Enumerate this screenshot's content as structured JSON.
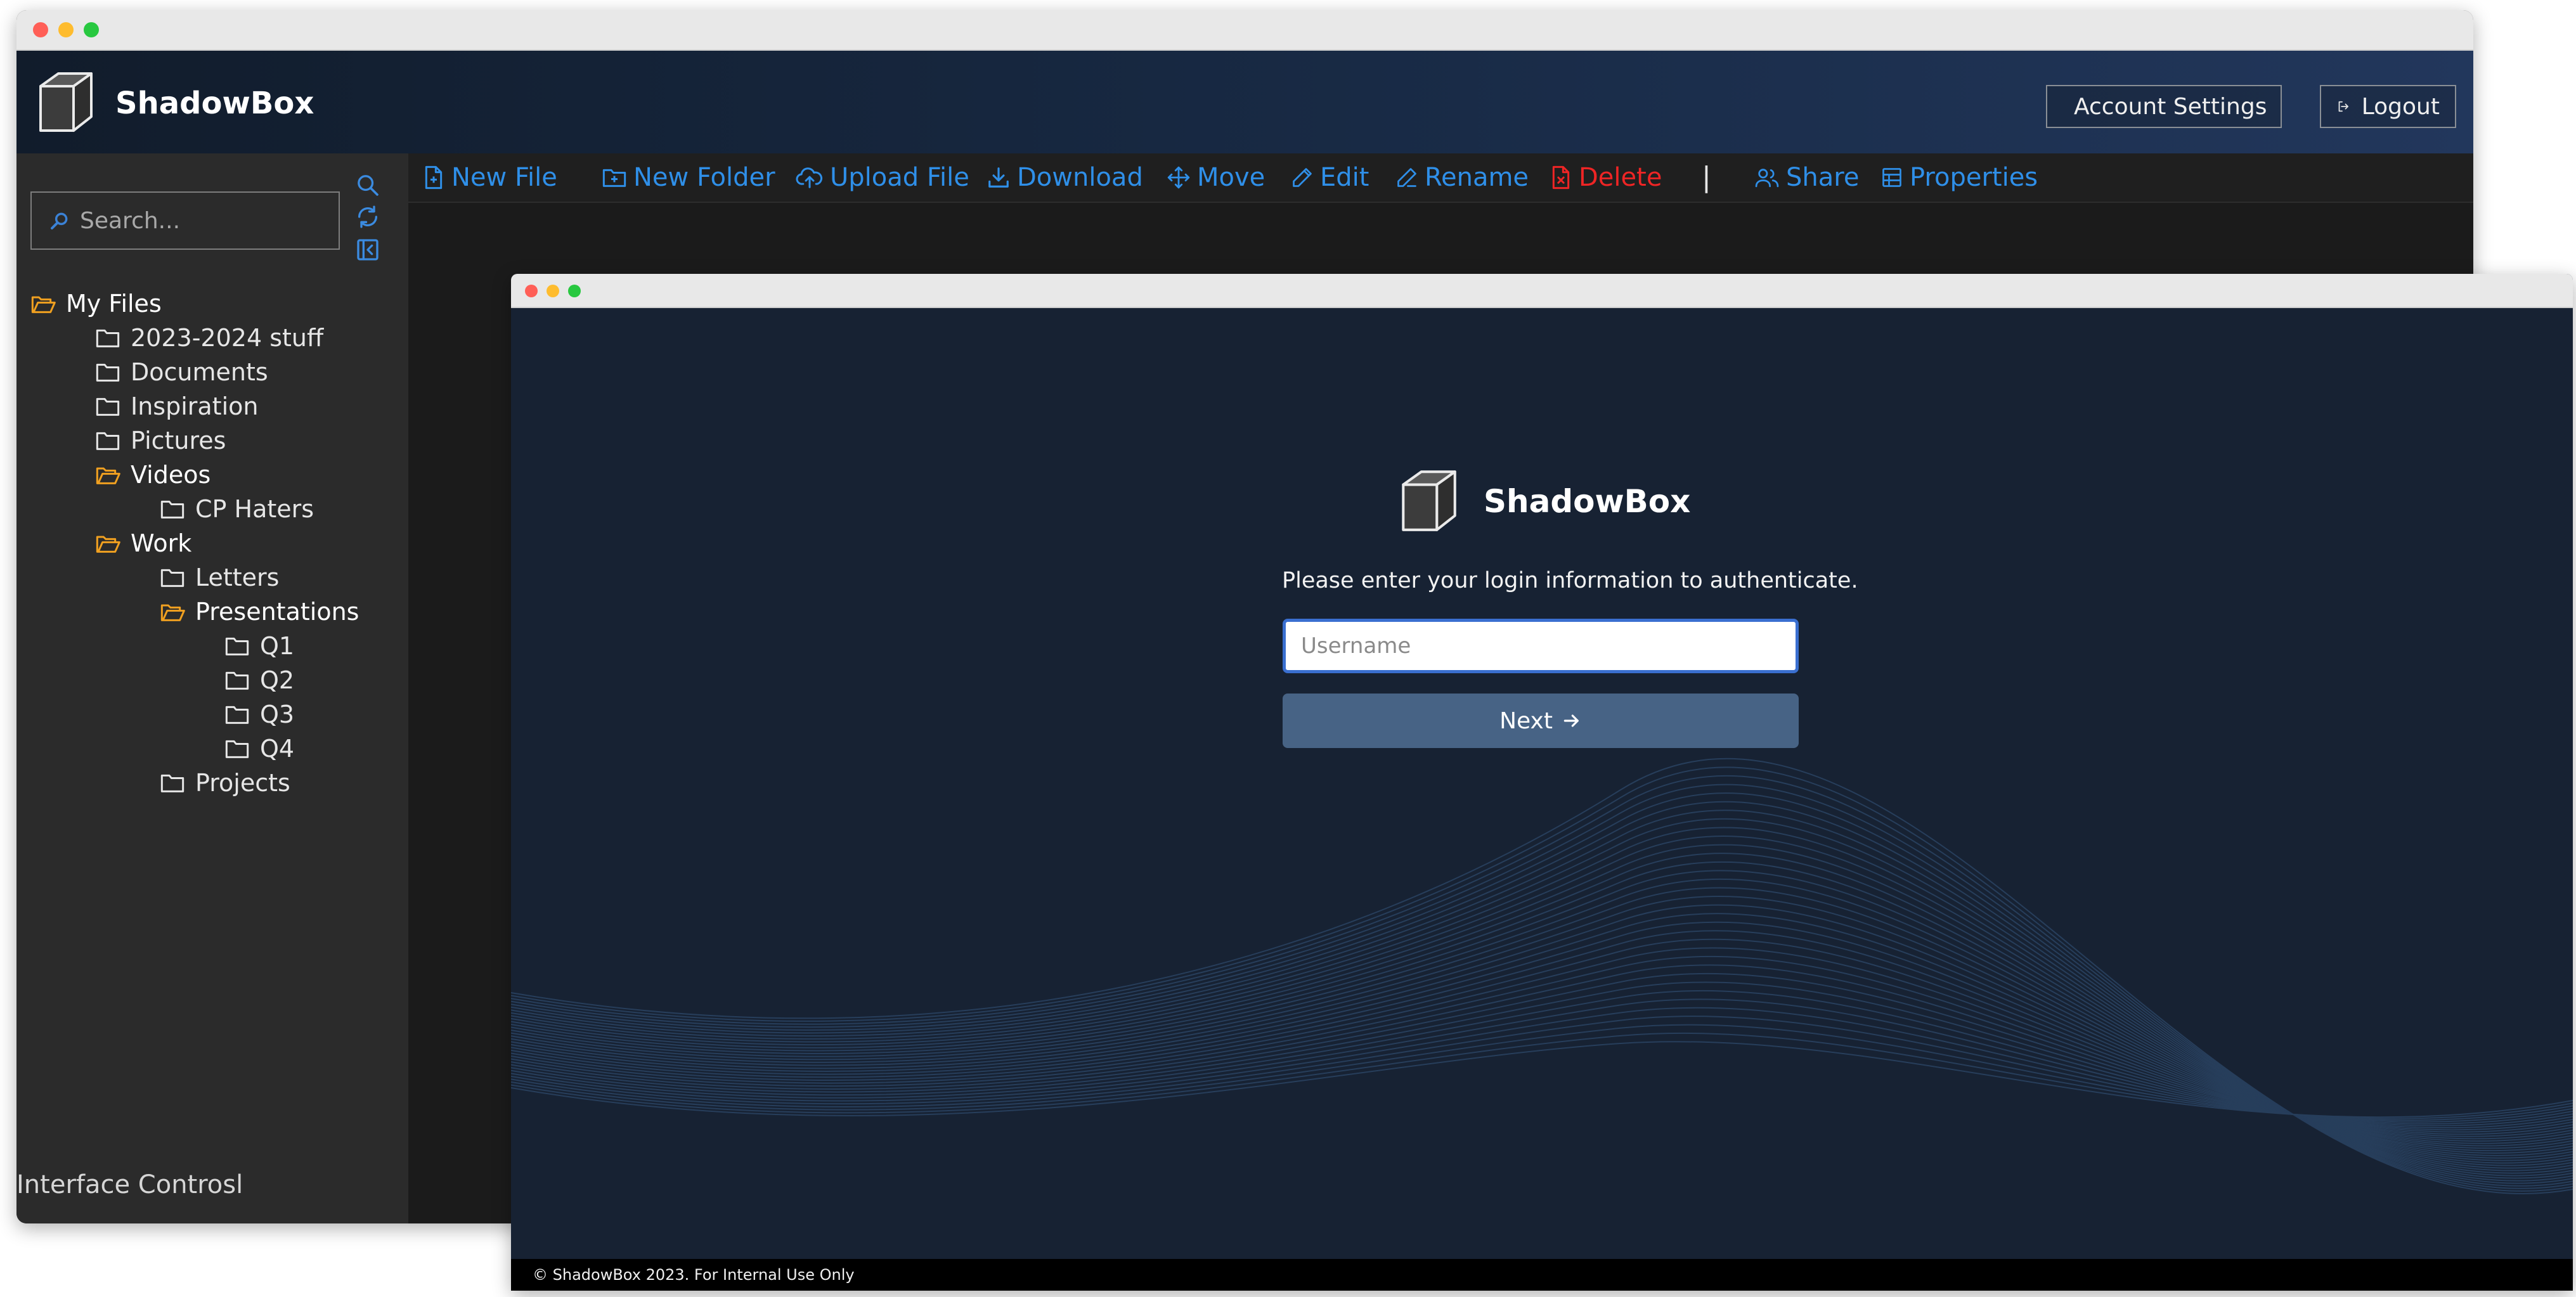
{
  "app": {
    "name": "ShadowBox"
  },
  "header": {
    "account_settings_label": "Account Settings",
    "logout_label": "Logout"
  },
  "sidebar": {
    "search_placeholder": "Search...",
    "tree": [
      {
        "label": "My Files",
        "open": true
      },
      {
        "label": "2023-2024 stuff",
        "open": false
      },
      {
        "label": "Documents",
        "open": false
      },
      {
        "label": "Inspiration",
        "open": false
      },
      {
        "label": "Pictures",
        "open": false
      },
      {
        "label": "Videos",
        "open": true
      },
      {
        "label": "CP Haters",
        "open": false
      },
      {
        "label": "Work",
        "open": true
      },
      {
        "label": "Letters",
        "open": false
      },
      {
        "label": "Presentations",
        "open": true
      },
      {
        "label": "Q1",
        "open": false
      },
      {
        "label": "Q2",
        "open": false
      },
      {
        "label": "Q3",
        "open": false
      },
      {
        "label": "Q4",
        "open": false
      },
      {
        "label": "Projects",
        "open": false
      }
    ],
    "footer_label": "Interface Controsl"
  },
  "toolbar": {
    "new_file": "New File",
    "new_folder": "New Folder",
    "upload_file": "Upload File",
    "download": "Download",
    "move": "Move",
    "edit": "Edit",
    "rename": "Rename",
    "delete": "Delete",
    "separator": "|",
    "share": "Share",
    "properties": "Properties"
  },
  "login": {
    "brand": "ShadowBox",
    "prompt": "Please enter your login information to authenticate.",
    "username_placeholder": "Username",
    "username_value": "",
    "next_label": "Next",
    "footer": "© ShadowBox 2023. For Internal Use Only"
  },
  "colors": {
    "link_blue": "#2f8fe8",
    "danger_red": "#ee2525",
    "folder_open_orange": "#f0a020",
    "header_navy": "#182a45",
    "login_bg": "#172233",
    "next_button": "#476385"
  },
  "icons": {
    "brand": "cube-icon",
    "account_settings": "gear-icon",
    "logout": "logout-icon",
    "search": "search-icon",
    "refresh": "refresh-icon",
    "collapse": "collapse-sidebar-icon",
    "folder": "folder-icon",
    "folder_open": "folder-open-icon",
    "new_file": "file-plus-icon",
    "new_folder": "folder-plus-icon",
    "upload": "cloud-upload-icon",
    "download": "download-icon",
    "move": "move-arrows-icon",
    "edit": "pencil-icon",
    "rename": "pen-icon",
    "delete": "file-delete-icon",
    "share": "people-icon",
    "properties": "table-icon",
    "next": "arrow-right-icon"
  }
}
